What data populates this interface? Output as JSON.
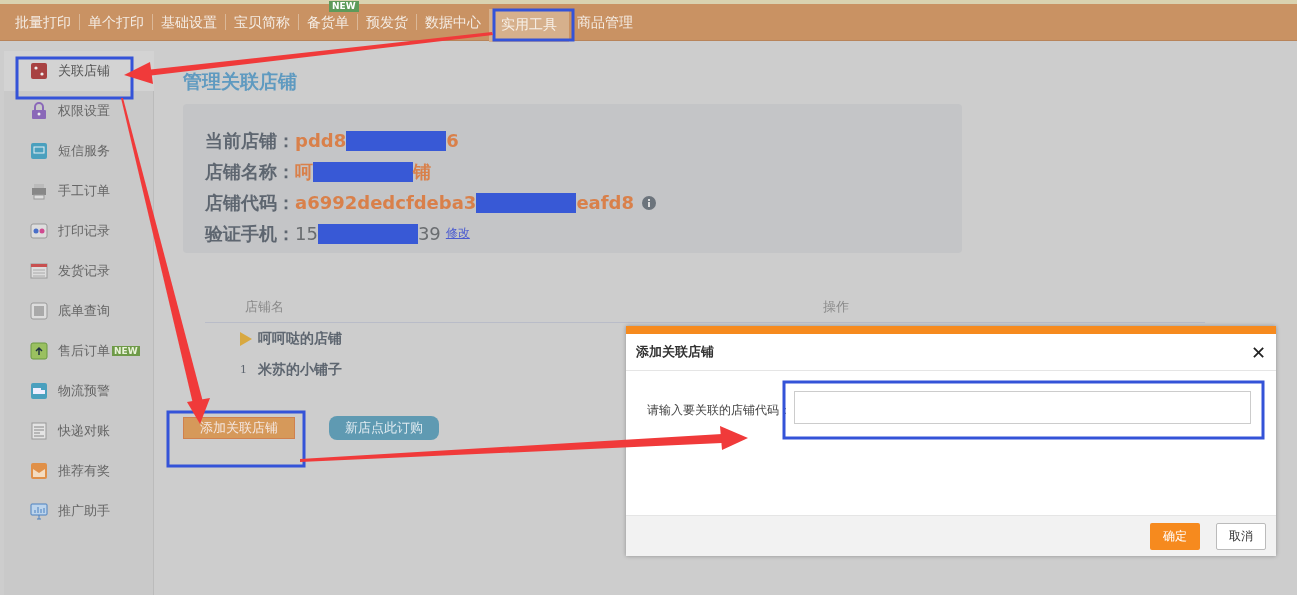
{
  "nav": {
    "tabs": [
      {
        "label": "批量打印",
        "selected": false
      },
      {
        "label": "单个打印",
        "selected": false
      },
      {
        "label": "基础设置",
        "selected": false
      },
      {
        "label": "宝贝简称",
        "selected": false
      },
      {
        "label": "备货单",
        "selected": false,
        "badge": "NEW"
      },
      {
        "label": "预发货",
        "selected": false
      },
      {
        "label": "数据中心",
        "selected": false
      },
      {
        "label": "实用工具",
        "selected": true
      },
      {
        "label": "商品管理",
        "selected": false
      }
    ]
  },
  "sidebar": {
    "items": [
      {
        "label": "关联店铺",
        "selected": true
      },
      {
        "label": "权限设置",
        "selected": false
      },
      {
        "label": "短信服务",
        "selected": false
      },
      {
        "label": "手工订单",
        "selected": false
      },
      {
        "label": "打印记录",
        "selected": false
      },
      {
        "label": "发货记录",
        "selected": false
      },
      {
        "label": "底单查询",
        "selected": false
      },
      {
        "label": "售后订单",
        "selected": false,
        "badge": "NEW"
      },
      {
        "label": "物流预警",
        "selected": false
      },
      {
        "label": "快递对账",
        "selected": false
      },
      {
        "label": "推荐有奖",
        "selected": false
      },
      {
        "label": "推广助手",
        "selected": false
      }
    ]
  },
  "page_title": "管理关联店铺",
  "shop_info": [
    {
      "label": "当前店铺：",
      "kind": "highlight",
      "value_start": "pdd8",
      "redacted": true,
      "value_end": "6"
    },
    {
      "label": "店铺名称：",
      "kind": "highlight",
      "value_start": "呵",
      "redacted": true,
      "value_end": "铺"
    },
    {
      "label": "店铺代码：",
      "kind": "highlight",
      "value_start": "a6992dedcfdeba3",
      "redacted": true,
      "value_end": "eafd8",
      "info": true
    },
    {
      "label": "验证手机：",
      "kind": "plain",
      "value_start": "15",
      "redacted": true,
      "value_end": "39",
      "link": "修改"
    }
  ],
  "table": {
    "columns": [
      "店铺名",
      "操作"
    ],
    "rows": [
      {
        "current": true,
        "name": "呵呵哒的店铺"
      },
      {
        "current": false,
        "index": "1",
        "name": "米苏的小铺子"
      }
    ]
  },
  "buttons": {
    "add": "添加关联店铺",
    "order": "新店点此订购"
  },
  "dialog": {
    "title": "添加关联店铺",
    "close": "✕",
    "field_label": "请输入要关联的店铺代码：",
    "buttons": [
      {
        "label": "确定",
        "kind": "primary"
      },
      {
        "label": "取消",
        "kind": "secondary"
      }
    ]
  }
}
